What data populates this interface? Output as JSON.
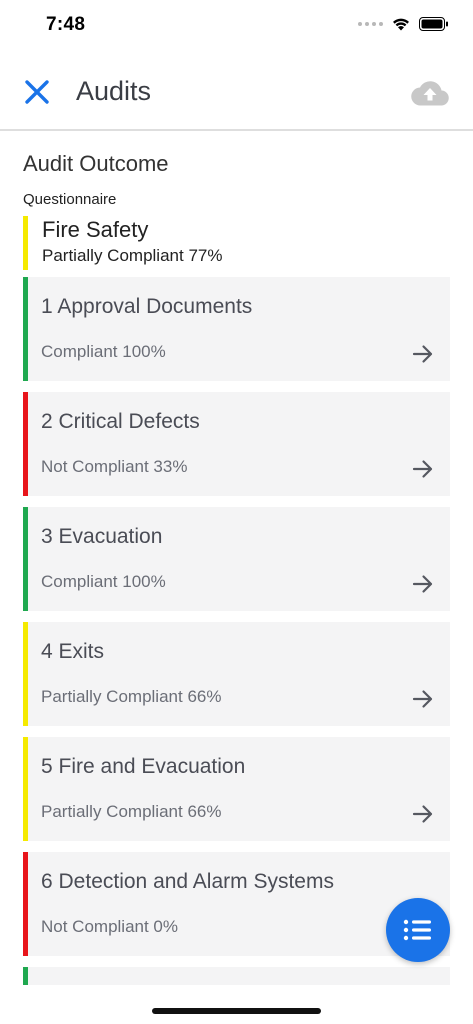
{
  "status_bar": {
    "time": "7:48"
  },
  "nav": {
    "title": "Audits",
    "close_icon": "close-icon",
    "upload_icon": "cloud-upload-icon"
  },
  "outcome": {
    "heading": "Audit Outcome",
    "questionnaire_label": "Questionnaire",
    "title": "Fire Safety",
    "status": "Partially Compliant 77%",
    "status_color": "#f5ea00"
  },
  "sections": [
    {
      "title": "1 Approval Documents",
      "status": "Compliant 100%",
      "color": "#1fa84f"
    },
    {
      "title": "2 Critical Defects",
      "status": "Not Compliant 33%",
      "color": "#e8151b"
    },
    {
      "title": "3 Evacuation",
      "status": "Compliant 100%",
      "color": "#1fa84f"
    },
    {
      "title": "4 Exits",
      "status": "Partially Compliant 66%",
      "color": "#f5ea00"
    },
    {
      "title": "5 Fire and Evacuation",
      "status": "Partially Compliant 66%",
      "color": "#f5ea00"
    },
    {
      "title": "6 Detection and Alarm Systems",
      "status": "Not Compliant 0%",
      "color": "#e8151b"
    }
  ],
  "next_section_color": "#1fa84f",
  "colors": {
    "accent": "#1a73e8",
    "card_bg": "#f4f4f5"
  },
  "fab": {
    "icon": "list-icon"
  }
}
